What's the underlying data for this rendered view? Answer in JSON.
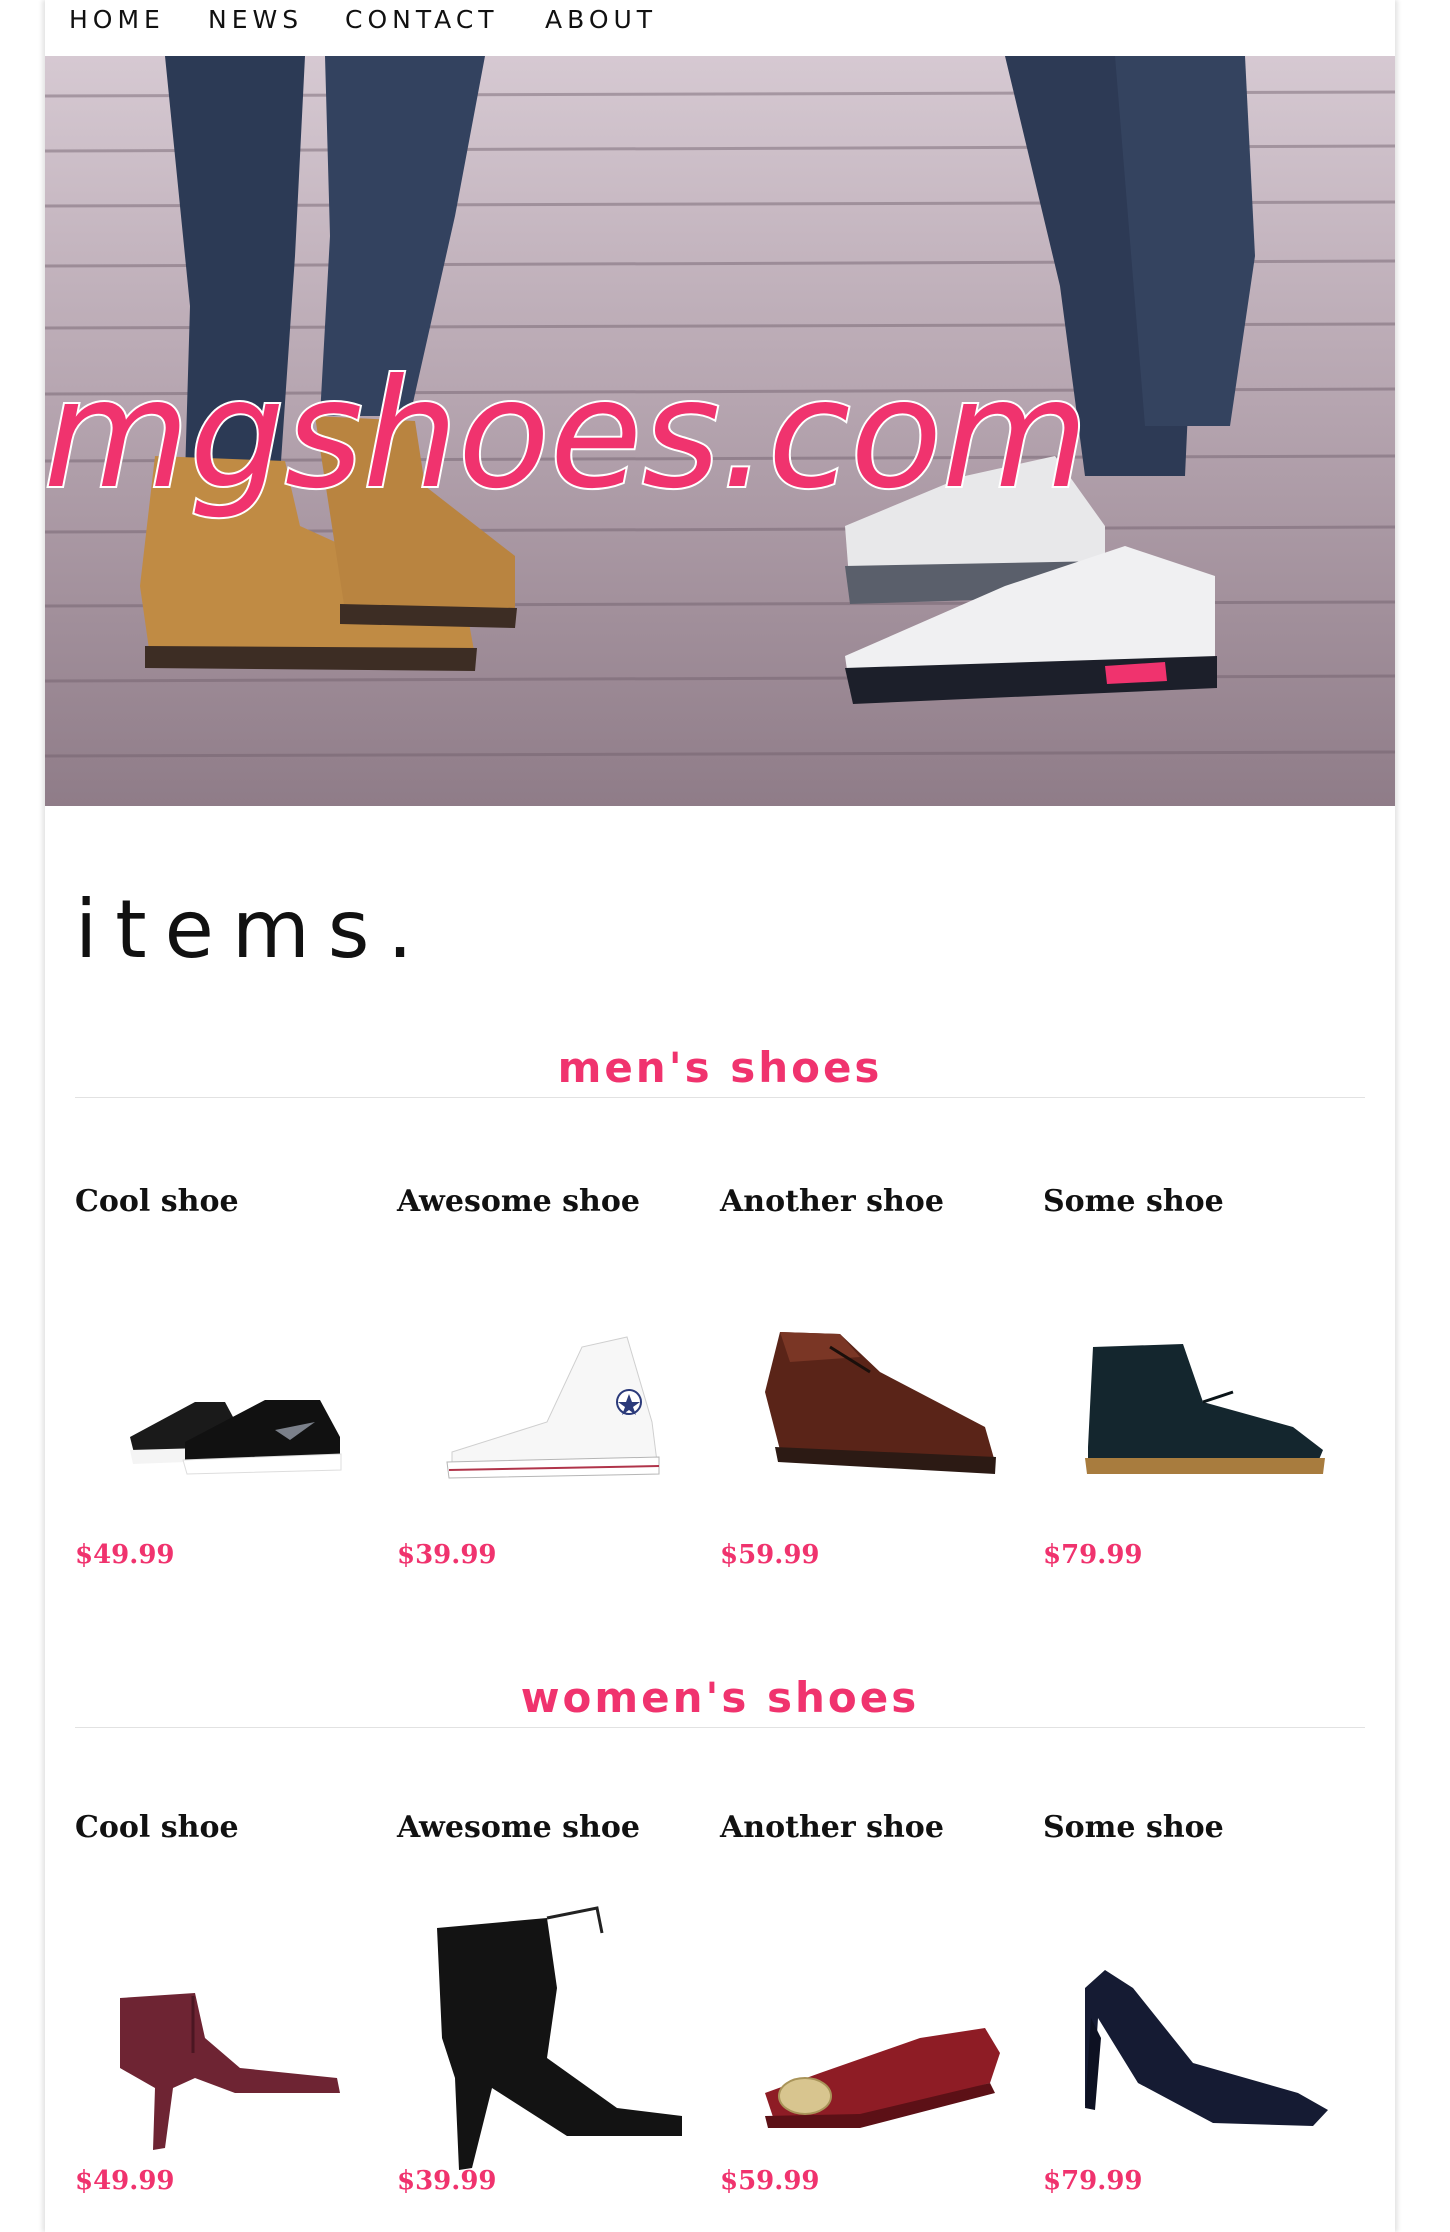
{
  "nav": {
    "items": [
      "HOME",
      "NEWS",
      "CONTACT",
      "ABOUT"
    ]
  },
  "hero": {
    "logo_text": "omgshoes.com"
  },
  "items_title": "items.",
  "categories": [
    {
      "title": "men's shoes",
      "products": [
        {
          "name": "Cool shoe",
          "price": "$49.99",
          "image": "black-running-sneakers"
        },
        {
          "name": "Awesome shoe",
          "price": "$39.99",
          "image": "white-high-top-canvas"
        },
        {
          "name": "Another shoe",
          "price": "$59.99",
          "image": "brown-leather-oxford"
        },
        {
          "name": "Some shoe",
          "price": "$79.99",
          "image": "navy-suede-chukka"
        }
      ]
    },
    {
      "title": "women's shoes",
      "products": [
        {
          "name": "Cool shoe",
          "price": "$49.99",
          "image": "burgundy-ankle-bootie"
        },
        {
          "name": "Awesome shoe",
          "price": "$39.99",
          "image": "black-peep-toe-bootie"
        },
        {
          "name": "Another shoe",
          "price": "$59.99",
          "image": "red-ballet-flat"
        },
        {
          "name": "Some shoe",
          "price": "$79.99",
          "image": "navy-pump"
        }
      ]
    }
  ],
  "colors": {
    "accent": "#f0336e",
    "text": "#111111",
    "rule": "#e2e2e2"
  }
}
